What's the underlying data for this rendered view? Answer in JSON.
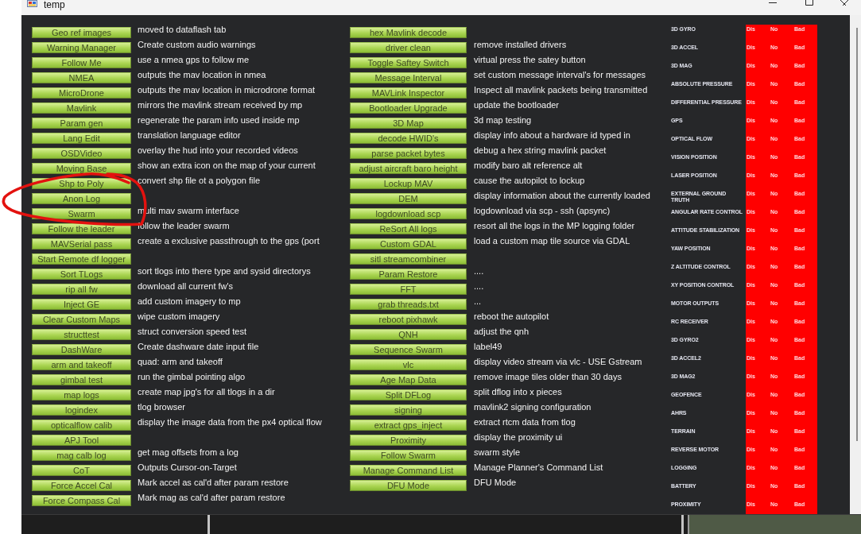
{
  "window": {
    "title": "temp"
  },
  "tool_columns": [
    {
      "rows": [
        {
          "button": "Geo ref images",
          "description": "moved to dataflash tab"
        },
        {
          "button": "Warning Manager",
          "description": "Create custom audio warnings"
        },
        {
          "button": "Follow Me",
          "description": "use a nmea gps to follow me"
        },
        {
          "button": "NMEA",
          "description": "outputs the mav location in nmea"
        },
        {
          "button": "MicroDrone",
          "description": "outputs the mav location in microdrone format"
        },
        {
          "button": "Mavlink",
          "description": "mirrors the mavlink stream received by mp"
        },
        {
          "button": "Param gen",
          "description": "regenerate the param info used inside mp"
        },
        {
          "button": "Lang Edit",
          "description": "translation language editor"
        },
        {
          "button": "OSDVideo",
          "description": "overlay the hud into your recorded videos"
        },
        {
          "button": "Moving Base",
          "description": "show an extra icon on the map of your current"
        },
        {
          "button": "Shp to Poly",
          "description": "convert shp file ot a polygon file"
        },
        {
          "button": "Anon Log"
        },
        {
          "button": "Swarm",
          "description": "multi mav swarm interface"
        },
        {
          "button": "Follow the leader",
          "description": "follow the leader swarm"
        },
        {
          "button": "MAVSerial pass",
          "description": "create a exclusive passthrough to the gps (port"
        },
        {
          "button": "Start Remote df logger"
        },
        {
          "button": "Sort TLogs",
          "description": "sort tlogs into there type and sysid directorys"
        },
        {
          "button": "rip all fw",
          "description": "download all current fw's"
        },
        {
          "button": "Inject GE",
          "description": "add custom imagery to mp"
        },
        {
          "button": "Clear Custom Maps",
          "description": "wipe custom imagery"
        },
        {
          "button": "structtest",
          "description": "struct conversion speed test"
        },
        {
          "button": "DashWare",
          "description": "Create dashware date input file"
        },
        {
          "button": "arm and takeoff",
          "description": "quad: arm and takeoff"
        },
        {
          "button": "gimbal test",
          "description": "run the gimbal pointing algo"
        },
        {
          "button": "map logs",
          "description": "create map jpg's for all tlogs in a dir"
        },
        {
          "button": "logindex",
          "description": "tlog browser"
        },
        {
          "button": "opticalflow calib",
          "description": "display the image data from the px4 optical flow"
        },
        {
          "button": "APJ Tool"
        },
        {
          "button": "mag calb log",
          "description": "get mag offsets from a log"
        },
        {
          "button": "CoT",
          "description": "Outputs Cursor-on-Target"
        },
        {
          "button": "Force Accel Cal",
          "description": "Mark accel as cal'd after param restore"
        },
        {
          "button": "Force Compass Cal",
          "description": "Mark mag as cal'd after param restore"
        }
      ]
    },
    {
      "rows": [
        {
          "button": "hex Mavlink decode"
        },
        {
          "button": "driver clean",
          "description": "remove installed drivers"
        },
        {
          "button": "Toggle Saftey Switch",
          "description": "virtual press the satey button"
        },
        {
          "button": "Message Interval",
          "description": "set custom message interval's for messages"
        },
        {
          "button": "MAVLink Inspector",
          "description": "Inspect all mavlink packets being transmitted"
        },
        {
          "button": "Bootloader Upgrade",
          "description": "update the bootloader"
        },
        {
          "button": "3D Map",
          "description": "3d map testing"
        },
        {
          "button": "decode HWID's",
          "description": "display info about a hardware id typed in"
        },
        {
          "button": "parse packet bytes",
          "description": "debug a hex string mavlink packet"
        },
        {
          "button": "adjust aircraft baro height",
          "description": "modify baro alt reference alt"
        },
        {
          "button": "Lockup MAV",
          "description": "cause the autopilot to lockup"
        },
        {
          "button": "DEM",
          "description": "display information about the currently loaded"
        },
        {
          "button": "logdownload scp",
          "description": "logdownload via scp - ssh (apsync)"
        },
        {
          "button": "ReSort All logs",
          "description": "resort all the logs in the MP logging folder"
        },
        {
          "button": "Custom GDAL",
          "description": "load a custom map tile source via GDAL"
        },
        {
          "button": "sitl streamcombiner"
        },
        {
          "button": "Param Restore",
          "description": "...."
        },
        {
          "button": "FFT",
          "description": "...."
        },
        {
          "button": "grab threads.txt",
          "description": "..."
        },
        {
          "button": "reboot pixhawk",
          "description": "reboot the autopilot"
        },
        {
          "button": "QNH",
          "description": "adjust the qnh"
        },
        {
          "button": "Sequence Swarm",
          "description": "label49"
        },
        {
          "button": "vlc",
          "description": "display video stream via vlc - USE Gstream"
        },
        {
          "button": "Age Map Data",
          "description": "remove image tiles older than 30 days"
        },
        {
          "button": "Split DFLog",
          "description": "split dflog into x pieces"
        },
        {
          "button": "signing",
          "description": "mavlink2 signing configuration"
        },
        {
          "button": "extract gps_inject",
          "description": "extract rtcm data from tlog"
        },
        {
          "button": "Proximity",
          "description": "display the proximity ui"
        },
        {
          "button": "Follow Swarm",
          "description": "swarm style"
        },
        {
          "button": "Manage Command List",
          "description": "Manage Planner's Command List"
        },
        {
          "button": "DFU Mode",
          "description": "DFU Mode"
        }
      ]
    }
  ],
  "sensors": [
    {
      "name": "3D GYRO",
      "values": [
        "Dis",
        "No",
        "Bad"
      ]
    },
    {
      "name": "3D ACCEL",
      "values": [
        "Dis",
        "No",
        "Bad"
      ]
    },
    {
      "name": "3D MAG",
      "values": [
        "Dis",
        "No",
        "Bad"
      ]
    },
    {
      "name": "ABSOLUTE PRESSURE",
      "values": [
        "Dis",
        "No",
        "Bad"
      ]
    },
    {
      "name": "DIFFERENTIAL PRESSURE",
      "values": [
        "Dis",
        "No",
        "Bad"
      ]
    },
    {
      "name": "GPS",
      "values": [
        "Dis",
        "No",
        "Bad"
      ]
    },
    {
      "name": "OPTICAL FLOW",
      "values": [
        "Dis",
        "No",
        "Bad"
      ]
    },
    {
      "name": "VISION POSITION",
      "values": [
        "Dis",
        "No",
        "Bad"
      ]
    },
    {
      "name": "LASER POSITION",
      "values": [
        "Dis",
        "No",
        "Bad"
      ]
    },
    {
      "name": "EXTERNAL GROUND TRUTH",
      "values": [
        "Dis",
        "No",
        "Bad"
      ]
    },
    {
      "name": "ANGULAR RATE CONTROL",
      "values": [
        "Dis",
        "No",
        "Bad"
      ]
    },
    {
      "name": "ATTITUDE STABILIZATION",
      "values": [
        "Dis",
        "No",
        "Bad"
      ]
    },
    {
      "name": "YAW POSITION",
      "values": [
        "Dis",
        "No",
        "Bad"
      ]
    },
    {
      "name": "Z ALTITUDE CONTROL",
      "values": [
        "Dis",
        "No",
        "Bad"
      ]
    },
    {
      "name": "XY POSITION CONTROL",
      "values": [
        "Dis",
        "No",
        "Bad"
      ]
    },
    {
      "name": "MOTOR OUTPUTS",
      "values": [
        "Dis",
        "No",
        "Bad"
      ]
    },
    {
      "name": "RC RECEIVER",
      "values": [
        "Dis",
        "No",
        "Bad"
      ]
    },
    {
      "name": "3D GYRO2",
      "values": [
        "Dis",
        "No",
        "Bad"
      ]
    },
    {
      "name": "3D ACCEL2",
      "values": [
        "Dis",
        "No",
        "Bad"
      ]
    },
    {
      "name": "3D MAG2",
      "values": [
        "Dis",
        "No",
        "Bad"
      ]
    },
    {
      "name": "GEOFENCE",
      "values": [
        "Dis",
        "No",
        "Bad"
      ]
    },
    {
      "name": "AHRS",
      "values": [
        "Dis",
        "No",
        "Bad"
      ]
    },
    {
      "name": "TERRAIN",
      "values": [
        "Dis",
        "No",
        "Bad"
      ]
    },
    {
      "name": "REVERSE MOTOR",
      "values": [
        "Dis",
        "No",
        "Bad"
      ]
    },
    {
      "name": "LOGGING",
      "values": [
        "Dis",
        "No",
        "Bad"
      ]
    },
    {
      "name": "BATTERY",
      "values": [
        "Dis",
        "No",
        "Bad"
      ]
    },
    {
      "name": "PROXIMITY",
      "values": [
        "Dis",
        "No",
        "Bad"
      ]
    }
  ]
}
